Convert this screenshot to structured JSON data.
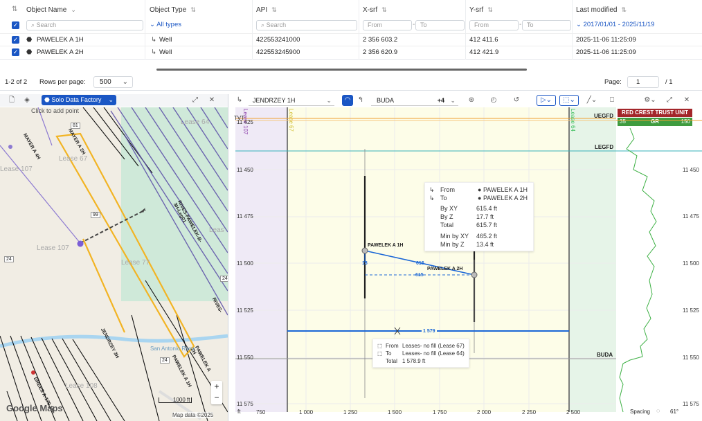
{
  "table": {
    "columns": [
      "Object Name",
      "Object Type",
      "API",
      "X-srf",
      "Y-srf",
      "Last modified"
    ],
    "filters": {
      "name_placeholder": "Search",
      "type_value": "All types",
      "api_placeholder": "Search",
      "x_from": "From",
      "x_to": "To",
      "y_from": "From",
      "y_to": "To",
      "date_value": "2017/01/01 - 2025/11/19"
    },
    "rows": [
      {
        "name": "PAWELEK A 1H",
        "type": "Well",
        "api": "422553241000",
        "x": "2 356 603.2",
        "y": "412 411.6",
        "modified": "2025-11-06 11:25:09"
      },
      {
        "name": "PAWELEK A 2H",
        "type": "Well",
        "api": "422553245900",
        "x": "2 356 620.9",
        "y": "412 421.9",
        "modified": "2025-11-06 11:25:09"
      }
    ]
  },
  "pager": {
    "range": "1-2 of 2",
    "rows_label": "Rows per page:",
    "rows_value": "500",
    "page_label": "Page:",
    "page_value": "1",
    "page_total": "/ 1"
  },
  "map": {
    "source_label": "Solo Data Factory",
    "hint": "Click to add point",
    "credit": "Google Maps",
    "data_credit": "Map data ©2025",
    "scale": "1000 ft",
    "labels": {
      "lease64": "Lease 64",
      "lease107a": "Lease 107",
      "lease67": "Lease 67",
      "lease107b": "Lease 107",
      "lease77": "Lease 77",
      "lease108": "Lease 108",
      "lease_side": "Leas",
      "mayer4h": "MAYER A 4H",
      "mayer2h": "MAYER A 2H",
      "rives8": "RIVES-PAWELEK-B-3H-Leg01",
      "rives_b": "RIVES-",
      "jendrzey": "JENDRZEY 3H",
      "pawelek2h": "PAWELEK A 2H",
      "pawelek1h": "PAWELEK A 1H",
      "drees": "DREES A-179 1H",
      "river": "San Antonio River",
      "r81": "81",
      "r99": "99",
      "r24": "24",
      "r27": "24",
      "r2": "24"
    }
  },
  "section": {
    "well": "JENDRZEY 1H",
    "surface": "BUDA",
    "count": "+4",
    "tvt": "TVT",
    "horizons": {
      "top": "UEGFD",
      "mid": "LEGFD",
      "buda": "BUDA"
    },
    "lease_left": "Lease 107",
    "lease_left2": "Lease 67",
    "lease_right": "Lease 64",
    "depths": [
      "11 425",
      "11 450",
      "11 475",
      "11 500",
      "11 525",
      "11 550",
      "11 575"
    ],
    "x_ticks": [
      "750",
      "1 000",
      "1 250",
      "1 500",
      "1 750",
      "2 000",
      "2 250",
      "2 500"
    ],
    "x_unit": "ft",
    "well1": "PAWELEK A 1H",
    "well2": "PAWELEK A 2H",
    "meas": {
      "m18": "18",
      "m616": "616",
      "m615": "615",
      "m1579": "1 579"
    },
    "info": {
      "from_label": "From",
      "from": "PAWELEK A 1H",
      "to_label": "To",
      "to": "PAWELEK A 2H",
      "rows": [
        [
          "By XY",
          "615.4 ft"
        ],
        [
          "By Z",
          "17.7 ft"
        ],
        [
          "Total",
          "615.7 ft"
        ]
      ],
      "rows2": [
        [
          "Min by XY",
          "465.2 ft"
        ],
        [
          "Min by Z",
          "13.4 ft"
        ]
      ]
    },
    "lease_info": {
      "from_label": "From",
      "from": "Leases- no fill (Lease 67)",
      "to_label": "To",
      "to": "Leases- no fill (Lease 64)",
      "total_label": "Total",
      "total": "1 578.9 ft"
    }
  },
  "log": {
    "title": "RED CREST TRUST UNIT",
    "curve": "GR",
    "min": "35",
    "max": "150",
    "depths": [
      "11 425",
      "11 450",
      "11 475",
      "11 500",
      "11 525",
      "11 550",
      "11 575"
    ],
    "spacing": "Spacing",
    "angle": "61°",
    "colors": {
      "title_bg": "#a3262a",
      "curve_bg": "#3f9b3f",
      "curve": "#3cb043"
    }
  },
  "colors": {
    "accent": "#1a56c4",
    "horizon_orange": "#f0a030",
    "horizon_teal": "#36b1b9",
    "lease_purple": "#8e44ad",
    "lease_green": "#3fbf5f",
    "section_bg": "#fdfde8"
  }
}
